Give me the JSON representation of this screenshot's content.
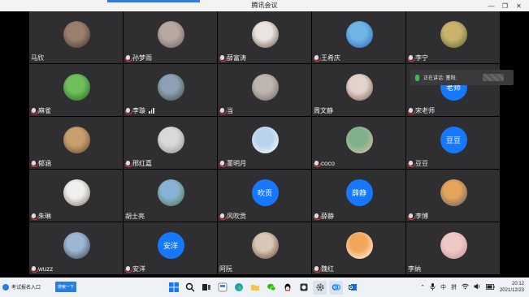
{
  "window": {
    "title": "腾讯会议",
    "controls": [
      "minimize",
      "maximize",
      "close"
    ]
  },
  "participants": [
    {
      "name": "马欣",
      "mic": false,
      "avatar": {
        "kind": "photo",
        "colors": [
          "#9a7f6e",
          "#3d2f2a"
        ]
      }
    },
    {
      "name": "孙梦雨",
      "mic": true,
      "avatar": {
        "kind": "photo",
        "colors": [
          "#b7a8a2",
          "#6b5b57"
        ]
      }
    },
    {
      "name": "薛富涛",
      "mic": true,
      "avatar": {
        "kind": "photo",
        "colors": [
          "#e9e4e0",
          "#5c4a3d"
        ]
      }
    },
    {
      "name": "王希庆",
      "mic": true,
      "avatar": {
        "kind": "photo",
        "colors": [
          "#6fb5e8",
          "#2b63b0"
        ]
      }
    },
    {
      "name": "李宁",
      "mic": true,
      "avatar": {
        "kind": "photo",
        "colors": [
          "#c9b36c",
          "#4c5e2e"
        ]
      }
    },
    {
      "name": "麻雀",
      "mic": true,
      "avatar": {
        "kind": "photo",
        "colors": [
          "#6fbf5a",
          "#1f5f25"
        ]
      }
    },
    {
      "name": "李璇",
      "mic": true,
      "signal": true,
      "avatar": {
        "kind": "photo",
        "colors": [
          "#8ea0b4",
          "#3b4a3f"
        ]
      }
    },
    {
      "name": "当",
      "mic": true,
      "avatar": {
        "kind": "photo",
        "colors": [
          "#bdb6b0",
          "#6a5f58"
        ]
      }
    },
    {
      "name": "周文静",
      "mic": false,
      "avatar": {
        "kind": "photo",
        "colors": [
          "#e4d3cc",
          "#7a5548"
        ]
      }
    },
    {
      "name": "宋老师",
      "mic": true,
      "avatar": {
        "kind": "text",
        "text": "老师"
      }
    },
    {
      "name": "郁涵",
      "mic": true,
      "avatar": {
        "kind": "photo",
        "colors": [
          "#c9a06b",
          "#5a4630"
        ]
      }
    },
    {
      "name": "邢红嘉",
      "mic": true,
      "avatar": {
        "kind": "photo",
        "colors": [
          "#d9d9d9",
          "#8a8a8a"
        ]
      }
    },
    {
      "name": "董明月",
      "mic": true,
      "avatar": {
        "kind": "photo",
        "colors": [
          "#b8d3ee",
          "#ffffff"
        ]
      }
    },
    {
      "name": "coco",
      "mic": true,
      "avatar": {
        "kind": "photo",
        "colors": [
          "#7eb08a",
          "#e2c6a8"
        ]
      }
    },
    {
      "name": "豆豆",
      "mic": true,
      "avatar": {
        "kind": "text",
        "text": "豆豆"
      }
    },
    {
      "name": "朱琳",
      "mic": true,
      "avatar": {
        "kind": "photo",
        "colors": [
          "#efefef",
          "#7a6a5a"
        ]
      }
    },
    {
      "name": "胡士亮",
      "mic": false,
      "avatar": {
        "kind": "photo",
        "colors": [
          "#89b3d6",
          "#4c6b3a"
        ]
      }
    },
    {
      "name": "风吹贡",
      "mic": true,
      "avatar": {
        "kind": "text",
        "text": "吹贡"
      }
    },
    {
      "name": "薛静",
      "mic": true,
      "avatar": {
        "kind": "text",
        "text": "薛静"
      }
    },
    {
      "name": "李博",
      "mic": true,
      "avatar": {
        "kind": "photo",
        "colors": [
          "#e6a35a",
          "#4b5a6c"
        ]
      }
    },
    {
      "name": "wuzz",
      "mic": true,
      "avatar": {
        "kind": "photo",
        "colors": [
          "#9bb7d4",
          "#3a3a3a"
        ]
      }
    },
    {
      "name": "安洋",
      "mic": true,
      "avatar": {
        "kind": "text",
        "text": "安洋"
      }
    },
    {
      "name": "阿阮",
      "mic": false,
      "avatar": {
        "kind": "photo",
        "colors": [
          "#d8c7b6",
          "#5a3d2b"
        ]
      }
    },
    {
      "name": "魏红",
      "mic": true,
      "avatar": {
        "kind": "photo",
        "colors": [
          "#f2a65a",
          "#ffffff"
        ]
      }
    },
    {
      "name": "李纳",
      "mic": false,
      "avatar": {
        "kind": "photo",
        "colors": [
          "#f0c8c8",
          "#c98f8f"
        ]
      }
    }
  ],
  "speaking": {
    "label": "正在讲话: 董阳;"
  },
  "taskbar": {
    "search_text": "考试报名入口",
    "search_button": "搜索一下",
    "ime_lang": "中",
    "ime_mode": "拼",
    "time": "20:12",
    "date": "2021/12/23",
    "colors": {
      "accent": "#2a7de1"
    }
  }
}
